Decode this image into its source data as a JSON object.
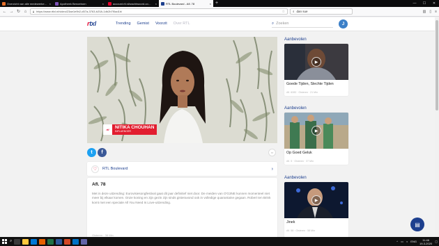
{
  "browser": {
    "tabs": [
      {
        "title": "Overzicht van alle medewerke…",
        "favicon_color": "#e8702a",
        "active": false
      },
      {
        "title": "Apotheek Benoeborn",
        "favicon_color": "#7b4fb5",
        "active": false
      },
      {
        "title": "account.rtl.nl/wachtwoord-vo…",
        "favicon_color": "#e4002b",
        "active": false
      },
      {
        "title": "RTL Boulevard - Afl. 78",
        "favicon_color": "#1d3f8e",
        "active": true
      }
    ],
    "new_tab": "+",
    "window_controls": [
      "—",
      "☐",
      "✕"
    ],
    "url": "https://www.rtlxl.nl/video/23ae1e9b2-d57a-3763-b20A-1db2b7f0ad1b/",
    "search_query": "dan sue",
    "back_icon": "back-arrow-icon",
    "forward_icon": "forward-arrow-icon",
    "reload_icon": "reload-icon"
  },
  "site": {
    "logo_r": "r",
    "logo_rest": "txl",
    "nav": [
      {
        "label": "Trending",
        "muted": false
      },
      {
        "label": "Gemist",
        "muted": false
      },
      {
        "label": "Voorzit",
        "muted": false
      },
      {
        "label": "Over RTL",
        "muted": true
      }
    ],
    "search_placeholder": "Zoeken",
    "avatar_letter": "J",
    "accent_color": "#1d3f8e",
    "brand_red": "#e4002b"
  },
  "video": {
    "name_tag_logo": "rtl",
    "person_name": "NITIKA CHOUHAN",
    "person_role": "INFLUENCER"
  },
  "social": {
    "twitter_glyph": "t",
    "facebook_glyph": "f",
    "share_icon": "link-icon"
  },
  "program": {
    "name": "RTL Boulevard",
    "chevron": "›"
  },
  "episode": {
    "title": "Afl. 78",
    "description": "Met in deze uitzending: Eurovisiesongfestival gaat dit jaar definitief niet door. De meiden van O'G3NE kunnen momenteel niet meer bij elkaar komen. Onze koning en zijn gezin zijn sinds gisteravond ook in volledige quarantaine gegaan. Robert ten Brink komt met een speciale All You Need Is Love-uitzending.",
    "meta": "Gisteren · 38 Min"
  },
  "recommended": {
    "heading": "Aanbevolen",
    "items": [
      {
        "title": "Goede Tijden, Slechte Tijden",
        "meta": "Afl. 6283 · Gisteren · 21 Min"
      },
      {
        "title": "Op Goed Geluk",
        "meta": "Afl. 5 · Gisteren · 37 Min"
      },
      {
        "title": "Jinek",
        "meta": "Afl. 58 · Gisteren · 58 Min"
      }
    ]
  },
  "taskbar": {
    "lang": "ENG",
    "time": "11:46",
    "date": "19-3-2020"
  }
}
